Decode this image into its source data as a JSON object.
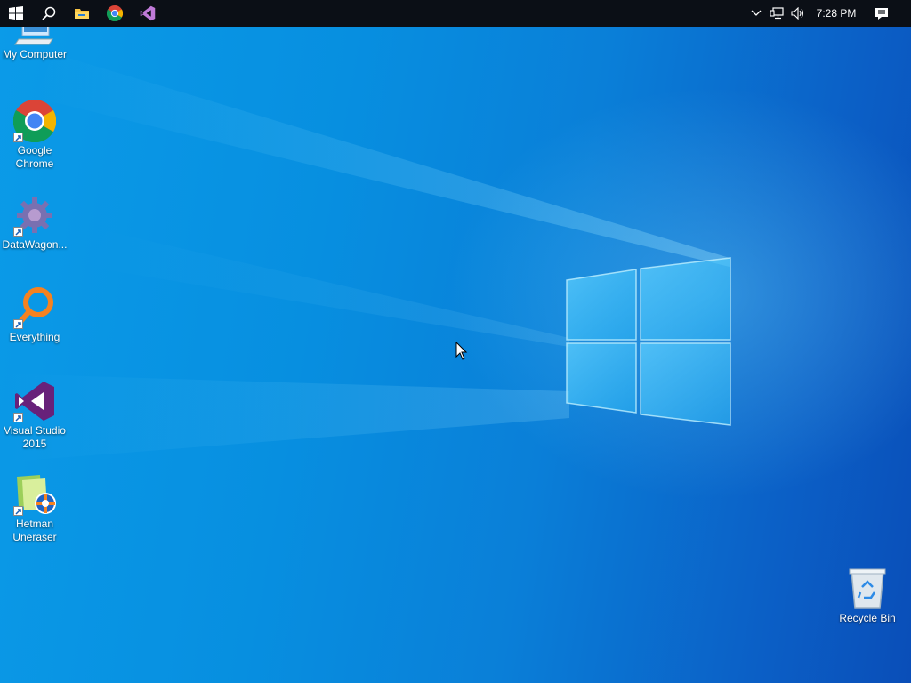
{
  "taskbar": {
    "start": {
      "icon": "windows-start-icon"
    },
    "search": {
      "icon": "search-icon"
    },
    "pinned": [
      {
        "name": "file-explorer",
        "icon": "folder-icon"
      },
      {
        "name": "google-chrome",
        "icon": "chrome-icon"
      },
      {
        "name": "visual-studio",
        "icon": "visual-studio-icon"
      }
    ],
    "tray": {
      "overflow_icon": "chevron-up-icon",
      "network_icon": "network-icon",
      "volume_icon": "volume-icon",
      "clock": "7:28 PM",
      "notifications_icon": "action-center-icon"
    }
  },
  "desktop": {
    "icons": [
      {
        "label": "My Computer",
        "icon": "computer-icon",
        "shortcut": false
      },
      {
        "label": "Google\nChrome",
        "icon": "chrome-icon",
        "shortcut": true
      },
      {
        "label": "DataWagon...",
        "icon": "datawagon-icon",
        "shortcut": true
      },
      {
        "label": "Everything",
        "icon": "everything-search-icon",
        "shortcut": true
      },
      {
        "label": "Visual Studio\n2015",
        "icon": "visual-studio-icon",
        "shortcut": true
      },
      {
        "label": "Hetman\nUneraser",
        "icon": "hetman-uneraser-icon",
        "shortcut": true
      },
      {
        "label": "Recycle Bin",
        "icon": "recycle-bin-icon",
        "shortcut": false
      }
    ]
  },
  "colors": {
    "taskbar": "#0b0f16",
    "wallpaper_light": "#0b9be8",
    "wallpaper_dark": "#0a4eb8",
    "chrome_red": "#db4437",
    "chrome_green": "#0f9d58",
    "chrome_yellow": "#f4b400",
    "chrome_blue": "#4285f4",
    "vs_purple": "#68217a",
    "everything_orange": "#f58220"
  }
}
